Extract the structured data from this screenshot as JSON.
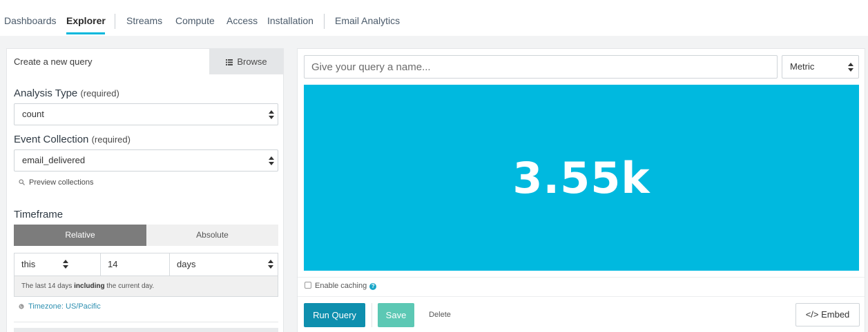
{
  "nav": {
    "items": [
      {
        "label": "Dashboards"
      },
      {
        "label": "Explorer",
        "active": true
      },
      {
        "label": "Streams"
      },
      {
        "label": "Compute"
      },
      {
        "label": "Access"
      },
      {
        "label": "Installation"
      },
      {
        "label": "Email Analytics"
      }
    ]
  },
  "left": {
    "tabs": {
      "create": "Create a new query",
      "browse": "Browse"
    },
    "analysis_type": {
      "label": "Analysis Type",
      "required": "(required)",
      "value": "count"
    },
    "event_collection": {
      "label": "Event Collection",
      "required": "(required)",
      "value": "email_delivered"
    },
    "preview_link": "Preview collections",
    "timeframe": {
      "label": "Timeframe",
      "modes": {
        "relative": "Relative",
        "absolute": "Absolute"
      },
      "relativity": "this",
      "amount": "14",
      "units": "days",
      "note_pre": "The last 14 days",
      "note_bold": "including",
      "note_post": "the current day."
    },
    "timezone": "Timezone: US/Pacific"
  },
  "right": {
    "name_placeholder": "Give your query a name...",
    "visualization": "Metric",
    "metric_value": "3.55k",
    "caching_label": "Enable caching",
    "help": "?",
    "buttons": {
      "run": "Run Query",
      "save": "Save",
      "delete": "Delete",
      "embed": "</> Embed"
    }
  },
  "colors": {
    "accent": "#00b7dc",
    "metric_bg": "#00b9df",
    "run_button": "#0e8fae",
    "save_button": "#5cc8b4"
  }
}
